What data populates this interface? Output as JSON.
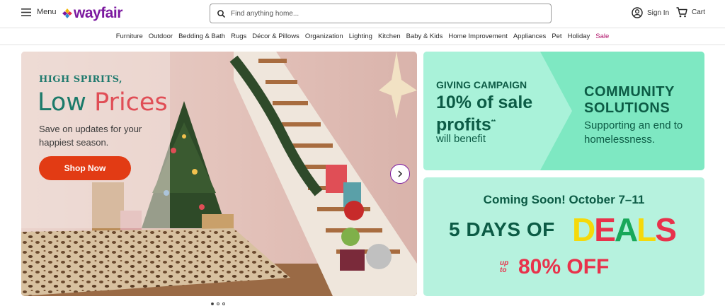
{
  "header": {
    "menu_label": "Menu",
    "logo_text": "wayfair",
    "search_placeholder": "Find anything home...",
    "signin_label": "Sign In",
    "cart_label": "Cart"
  },
  "nav": {
    "categories": [
      "Furniture",
      "Outdoor",
      "Bedding & Bath",
      "Rugs",
      "Décor & Pillows",
      "Organization",
      "Lighting",
      "Kitchen",
      "Baby & Kids",
      "Home Improvement",
      "Appliances",
      "Pet",
      "Holiday",
      "Sale"
    ]
  },
  "hero": {
    "kicker": "HIGH SPIRITS,",
    "title_part1": "Low ",
    "title_part2": "Prices",
    "subtitle": "Save on updates for your happiest season.",
    "button_label": "Shop Now",
    "slide_count": 3,
    "active_slide": 1
  },
  "promo_campaign": {
    "kicker": "GIVING CAMPAIGN",
    "headline_line1": "10% of sale",
    "headline_line2": "profits",
    "footnote_mark": "**",
    "subline": "will benefit",
    "title_line1": "COMMUNITY",
    "title_line2": "SOLUTIONS",
    "description": "Supporting an end to homelessness."
  },
  "promo_deals": {
    "coming_soon": "Coming Soon! October 7–11",
    "days_text": "5 DAYS OF",
    "deals_letters": [
      "D",
      "E",
      "A",
      "L",
      "S"
    ],
    "upto_line1": "up",
    "upto_line2": "to",
    "off_text": "80% OFF"
  },
  "colors": {
    "brand_purple": "#7b189f",
    "cta_red": "#e23b14",
    "sale_pink": "#b0136a",
    "promo_green_text": "#0c5b45",
    "promo_mint": "#a8f0d6",
    "deals_red": "#e8324b",
    "deals_yellow": "#f5d90a",
    "deals_green": "#18a85a"
  }
}
